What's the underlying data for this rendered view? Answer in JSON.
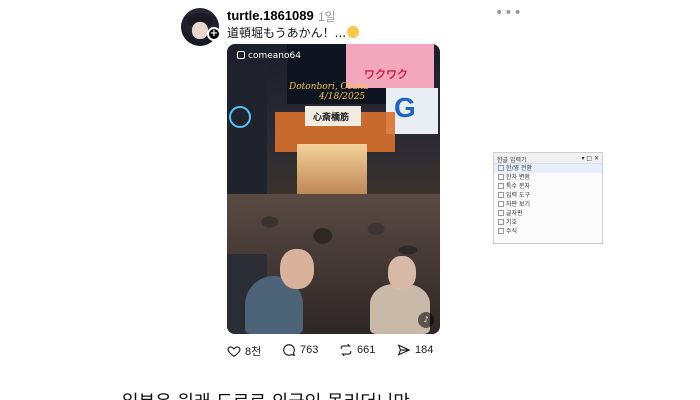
{
  "post": {
    "username": "turtle.1861089",
    "timestamp": "1일",
    "text": "道頓堀もうあかん！...",
    "follow_symbol": "+"
  },
  "media": {
    "watermark": "comeano64",
    "overlay_location": "Dotonbori, Osaka",
    "overlay_date": "4/18/2025",
    "sign_text": "ワクワク",
    "bridge_text": "心斎橋筋"
  },
  "actions": {
    "likes": "8천",
    "comments": "763",
    "reposts": "661",
    "shares": "184"
  },
  "ime_panel": {
    "title": "한글 입력기",
    "rows": [
      "한/영 전환",
      "한자 변환",
      "특수 문자",
      "입력 도구",
      "자판 보기",
      "글자판",
      "기호",
      "수식"
    ]
  },
  "bottom": {
    "text": "일본은 원래 도로로 외국인 몰리더니만"
  },
  "colors": {
    "timestamp": "#999999",
    "accent_overlay": "#f3c34a"
  }
}
